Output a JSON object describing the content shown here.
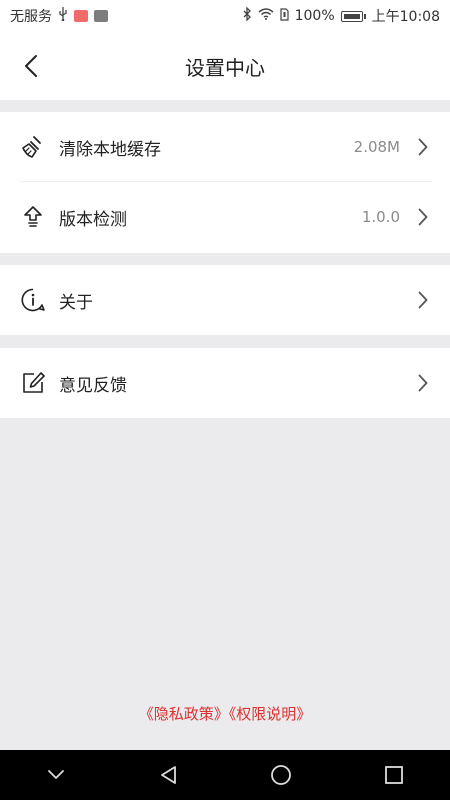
{
  "status_bar": {
    "carrier": "无服务",
    "battery_percent": "100%",
    "time": "上午10:08"
  },
  "header": {
    "title": "设置中心"
  },
  "settings": {
    "clear_cache": {
      "label": "清除本地缓存",
      "value": "2.08M",
      "icon": "broom-icon"
    },
    "version_check": {
      "label": "版本检测",
      "value": "1.0.0",
      "icon": "upload-arrow-icon"
    },
    "about": {
      "label": "关于",
      "icon": "info-icon"
    },
    "feedback": {
      "label": "意见反馈",
      "icon": "edit-icon"
    }
  },
  "footer": {
    "privacy_policy": "《隐私政策》",
    "permissions": "《权限说明》"
  },
  "colors": {
    "background": "#ebebed",
    "link_red": "#d9322f"
  }
}
